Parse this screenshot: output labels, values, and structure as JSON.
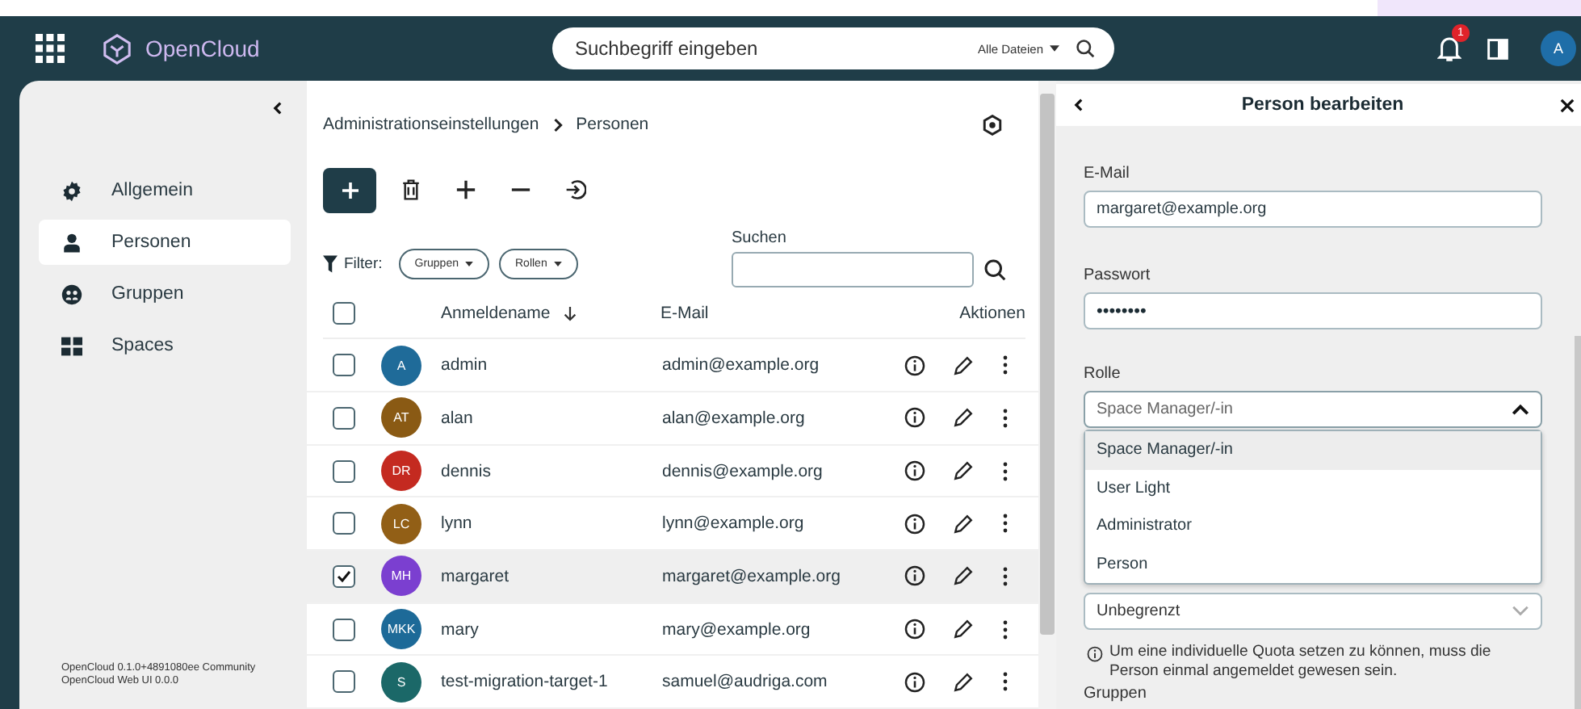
{
  "header": {
    "app_name": "OpenCloud",
    "search": {
      "placeholder": "Suchbegriff eingeben",
      "scope": "Alle Dateien"
    },
    "notifications_badge": "1",
    "avatar": "A"
  },
  "sidebar": {
    "items": [
      {
        "label": "Allgemein",
        "selected": false,
        "kind": "gear"
      },
      {
        "label": "Personen",
        "selected": true,
        "kind": "person"
      },
      {
        "label": "Gruppen",
        "selected": false,
        "kind": "group"
      },
      {
        "label": "Spaces",
        "selected": false,
        "kind": "grid"
      }
    ],
    "version_lines": [
      "OpenCloud 0.1.0+4891080ee Community",
      "OpenCloud Web UI 0.0.0"
    ]
  },
  "breadcrumb": [
    "Administrationseinstellungen",
    "Personen"
  ],
  "filter": {
    "label": "Filter:",
    "chips": [
      "Gruppen",
      "Rollen"
    ]
  },
  "search": {
    "label": "Suchen"
  },
  "table": {
    "all_checked": false,
    "columns": [
      "Anmeldename",
      "E-Mail",
      "Aktionen"
    ],
    "rows": [
      {
        "initials": "A",
        "color": "#1f6b99",
        "name": "admin",
        "email": "admin@example.org",
        "checked": false,
        "selected": false
      },
      {
        "initials": "AT",
        "color": "#8a5a14",
        "name": "alan",
        "email": "alan@example.org",
        "checked": false,
        "selected": false
      },
      {
        "initials": "DR",
        "color": "#c42a20",
        "name": "dennis",
        "email": "dennis@example.org",
        "checked": false,
        "selected": false
      },
      {
        "initials": "LC",
        "color": "#925f16",
        "name": "lynn",
        "email": "lynn@example.org",
        "checked": false,
        "selected": false
      },
      {
        "initials": "MH",
        "color": "#7b3fd0",
        "name": "margaret",
        "email": "margaret@example.org",
        "checked": true,
        "selected": true
      },
      {
        "initials": "MKK",
        "color": "#1d6a98",
        "name": "mary",
        "email": "mary@example.org",
        "checked": false,
        "selected": false
      },
      {
        "initials": "S",
        "color": "#1b6868",
        "name": "test-migration-target-1",
        "email": "samuel@audriga.com",
        "checked": false,
        "selected": false
      }
    ]
  },
  "panel": {
    "title": "Person bearbeiten",
    "email": {
      "label": "E-Mail",
      "value": "margaret@example.org"
    },
    "password": {
      "label": "Passwort",
      "value": "••••••••"
    },
    "role": {
      "label": "Rolle",
      "value": "Space Manager/-in",
      "expanded": true,
      "options": [
        {
          "label": "Space Manager/-in",
          "selected": true
        },
        {
          "label": "User Light",
          "selected": false
        },
        {
          "label": "Administrator",
          "selected": false
        },
        {
          "label": "Person",
          "selected": false
        }
      ]
    },
    "quota": {
      "value": "Unbegrenzt"
    },
    "note": "Um eine individuelle Quota setzen zu können, muss die Person einmal angemeldet gewesen sein.",
    "groups_label": "Gruppen"
  }
}
